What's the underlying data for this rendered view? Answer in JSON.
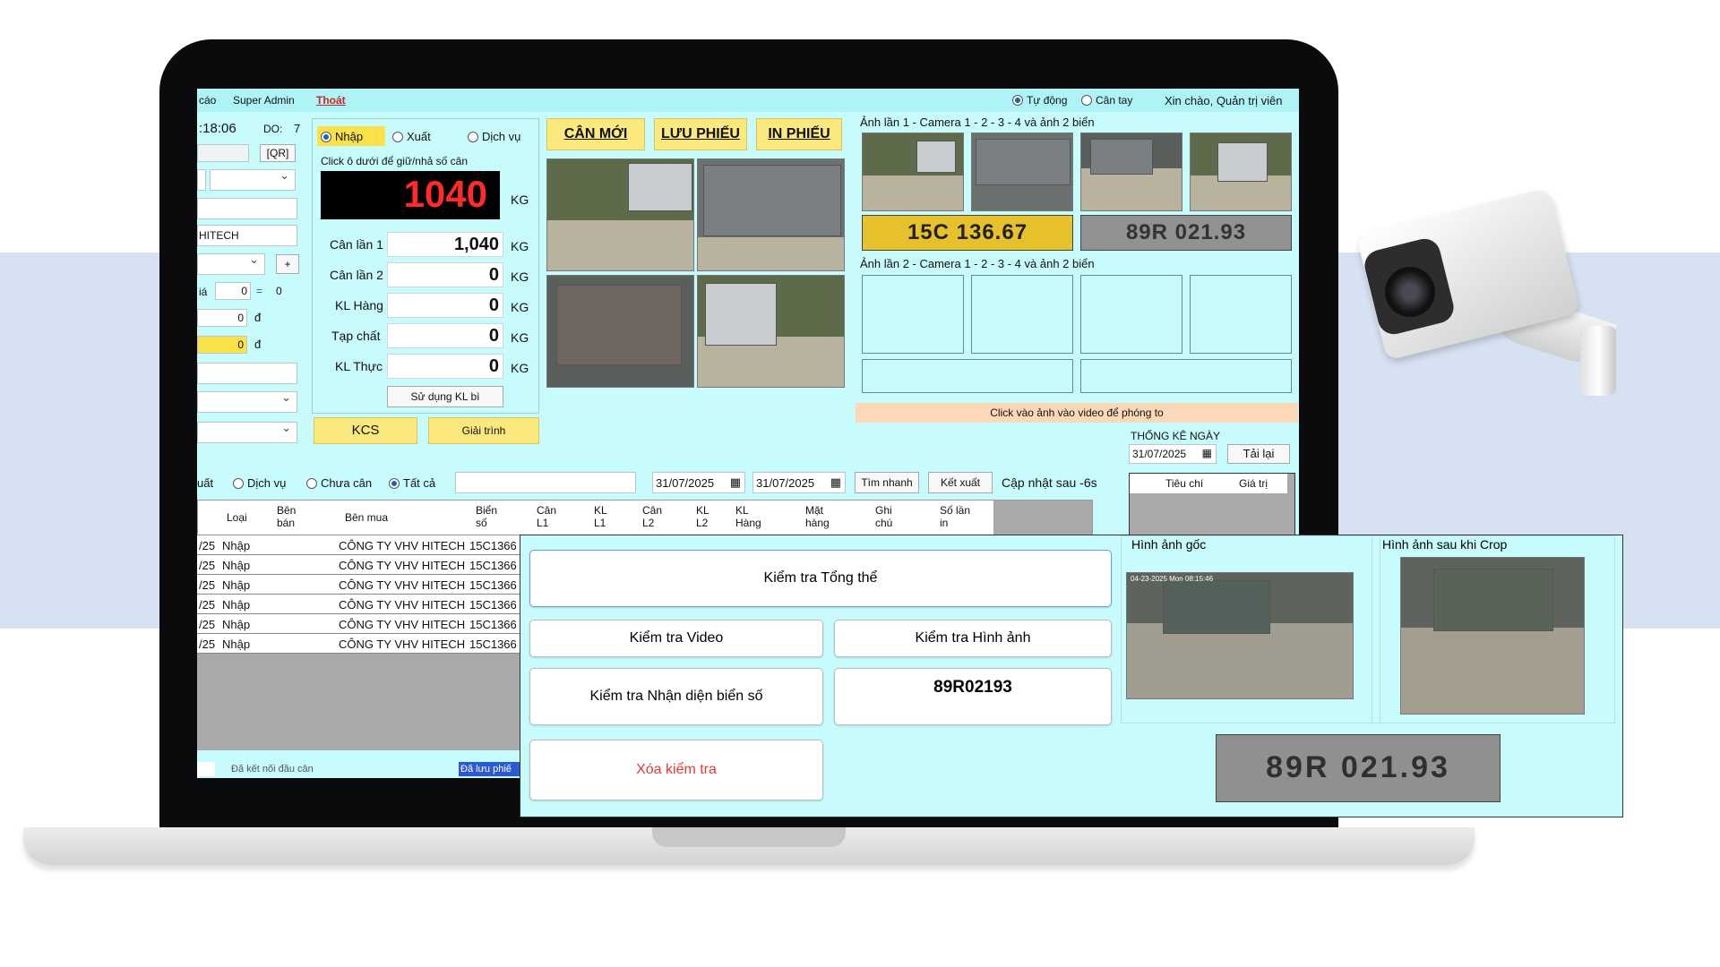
{
  "menu": {
    "report": "cáo",
    "user": "Super Admin",
    "exit": "Thoát",
    "mode_auto": "Tự động",
    "mode_manual": "Cân tay",
    "greeting": "Xin chào, Quản trị viên"
  },
  "left": {
    "time": ":18:06",
    "do_label": "DO:",
    "do_value": "7",
    "qr": "[QR]",
    "company": "HITECH",
    "plus": "+",
    "price_label": "iá",
    "price_value": "0",
    "eq": "=",
    "eq_value": "0",
    "money1": "0",
    "money1_unit": "đ",
    "money2": "0",
    "money2_unit": "đ"
  },
  "type_radio": {
    "import": "Nhập",
    "export": "Xuất",
    "service": "Dịch vụ"
  },
  "weigh": {
    "hint": "Click ô dưới để giữ/nhả số cân",
    "display": "1040",
    "unit": "KG",
    "rows": [
      {
        "label": "Cân lần 1",
        "value": "1,040",
        "unit": "KG"
      },
      {
        "label": "Cân lần 2",
        "value": "0",
        "unit": "KG"
      },
      {
        "label": "KL Hàng",
        "value": "0",
        "unit": "KG"
      },
      {
        "label": "Tạp chất",
        "value": "0",
        "unit": "KG"
      },
      {
        "label": "KL Thực",
        "value": "0",
        "unit": "KG"
      }
    ],
    "use_tare": "Sử dụng KL bì",
    "kcs": "KCS",
    "explain": "Giải trình"
  },
  "actions": {
    "new": "CÂN MỚI",
    "save": "LƯU PHIẾU",
    "print": "IN PHIẾU"
  },
  "cams": {
    "title1": "Ảnh lần 1 - Camera 1 - 2 - 3 - 4 và ảnh 2 biển",
    "title2": "Ảnh lần 2 - Camera 1 - 2 - 3 - 4 và ảnh 2 biển",
    "plate_a": "15C 136.67",
    "plate_b": "89R 021.93",
    "zoom_hint": "Click vào ảnh vào video để phóng to"
  },
  "stats": {
    "title": "THỐNG KÊ NGÀY",
    "date": "31/07/2025",
    "reload": "Tải lại",
    "col1": "Tiêu chí",
    "col2": "Giá trị"
  },
  "filter": {
    "export": "uất",
    "service": "Dịch vụ",
    "not_weighed": "Chưa cân",
    "all": "Tất cả",
    "date_from": "31/07/2025",
    "date_to": "31/07/2025",
    "quick_search": "Tìm nhanh",
    "export_btn": "Kết xuất",
    "update": "Cập nhật sau -6s"
  },
  "table": {
    "headers": [
      "Loại",
      "Bên bán",
      "Bên mua",
      "Biển số",
      "Cân L1",
      "KL L1",
      "Cân L2",
      "KL L2",
      "KL Hàng",
      "Mặt hàng",
      "Ghi chú",
      "Số lần in"
    ],
    "rows": [
      {
        "date": "/25",
        "type": "Nhập",
        "buyer": "CÔNG TY VHV HITECH",
        "plate": "15C1366"
      },
      {
        "date": "/25",
        "type": "Nhập",
        "buyer": "CÔNG TY VHV HITECH",
        "plate": "15C1366"
      },
      {
        "date": "/25",
        "type": "Nhập",
        "buyer": "CÔNG TY VHV HITECH",
        "plate": "15C1366"
      },
      {
        "date": "/25",
        "type": "Nhập",
        "buyer": "CÔNG TY VHV HITECH",
        "plate": "15C1366"
      },
      {
        "date": "/25",
        "type": "Nhập",
        "buyer": "CÔNG TY VHV HITECH",
        "plate": "15C1366"
      },
      {
        "date": "/25",
        "type": "Nhập",
        "buyer": "CÔNG TY VHV HITECH",
        "plate": "15C1366"
      }
    ]
  },
  "status": {
    "connected": "Đã kết nối đầu cân",
    "saved": "Đã lưu phiế"
  },
  "overlay": {
    "check_all": "Kiểm tra Tổng thể",
    "check_video": "Kiểm tra Video",
    "check_image": "Kiểm tra Hình ảnh",
    "check_plate": "Kiểm tra Nhận diện biển số",
    "plate_result": "89R02193",
    "clear": "Xóa kiểm tra",
    "orig_label": "Hình ảnh gốc",
    "crop_label": "Hình ảnh sau khi Crop",
    "plate_crop": "89R 021.93",
    "stamp": "04-23-2025 Mon 08:15:46"
  },
  "colors": {
    "screen_bg": "#c8fbfb",
    "accent_yellow": "#fbe97d",
    "display_red": "#ff2a2a",
    "band": "#d6e2f2",
    "clear_red": "#e53935"
  }
}
